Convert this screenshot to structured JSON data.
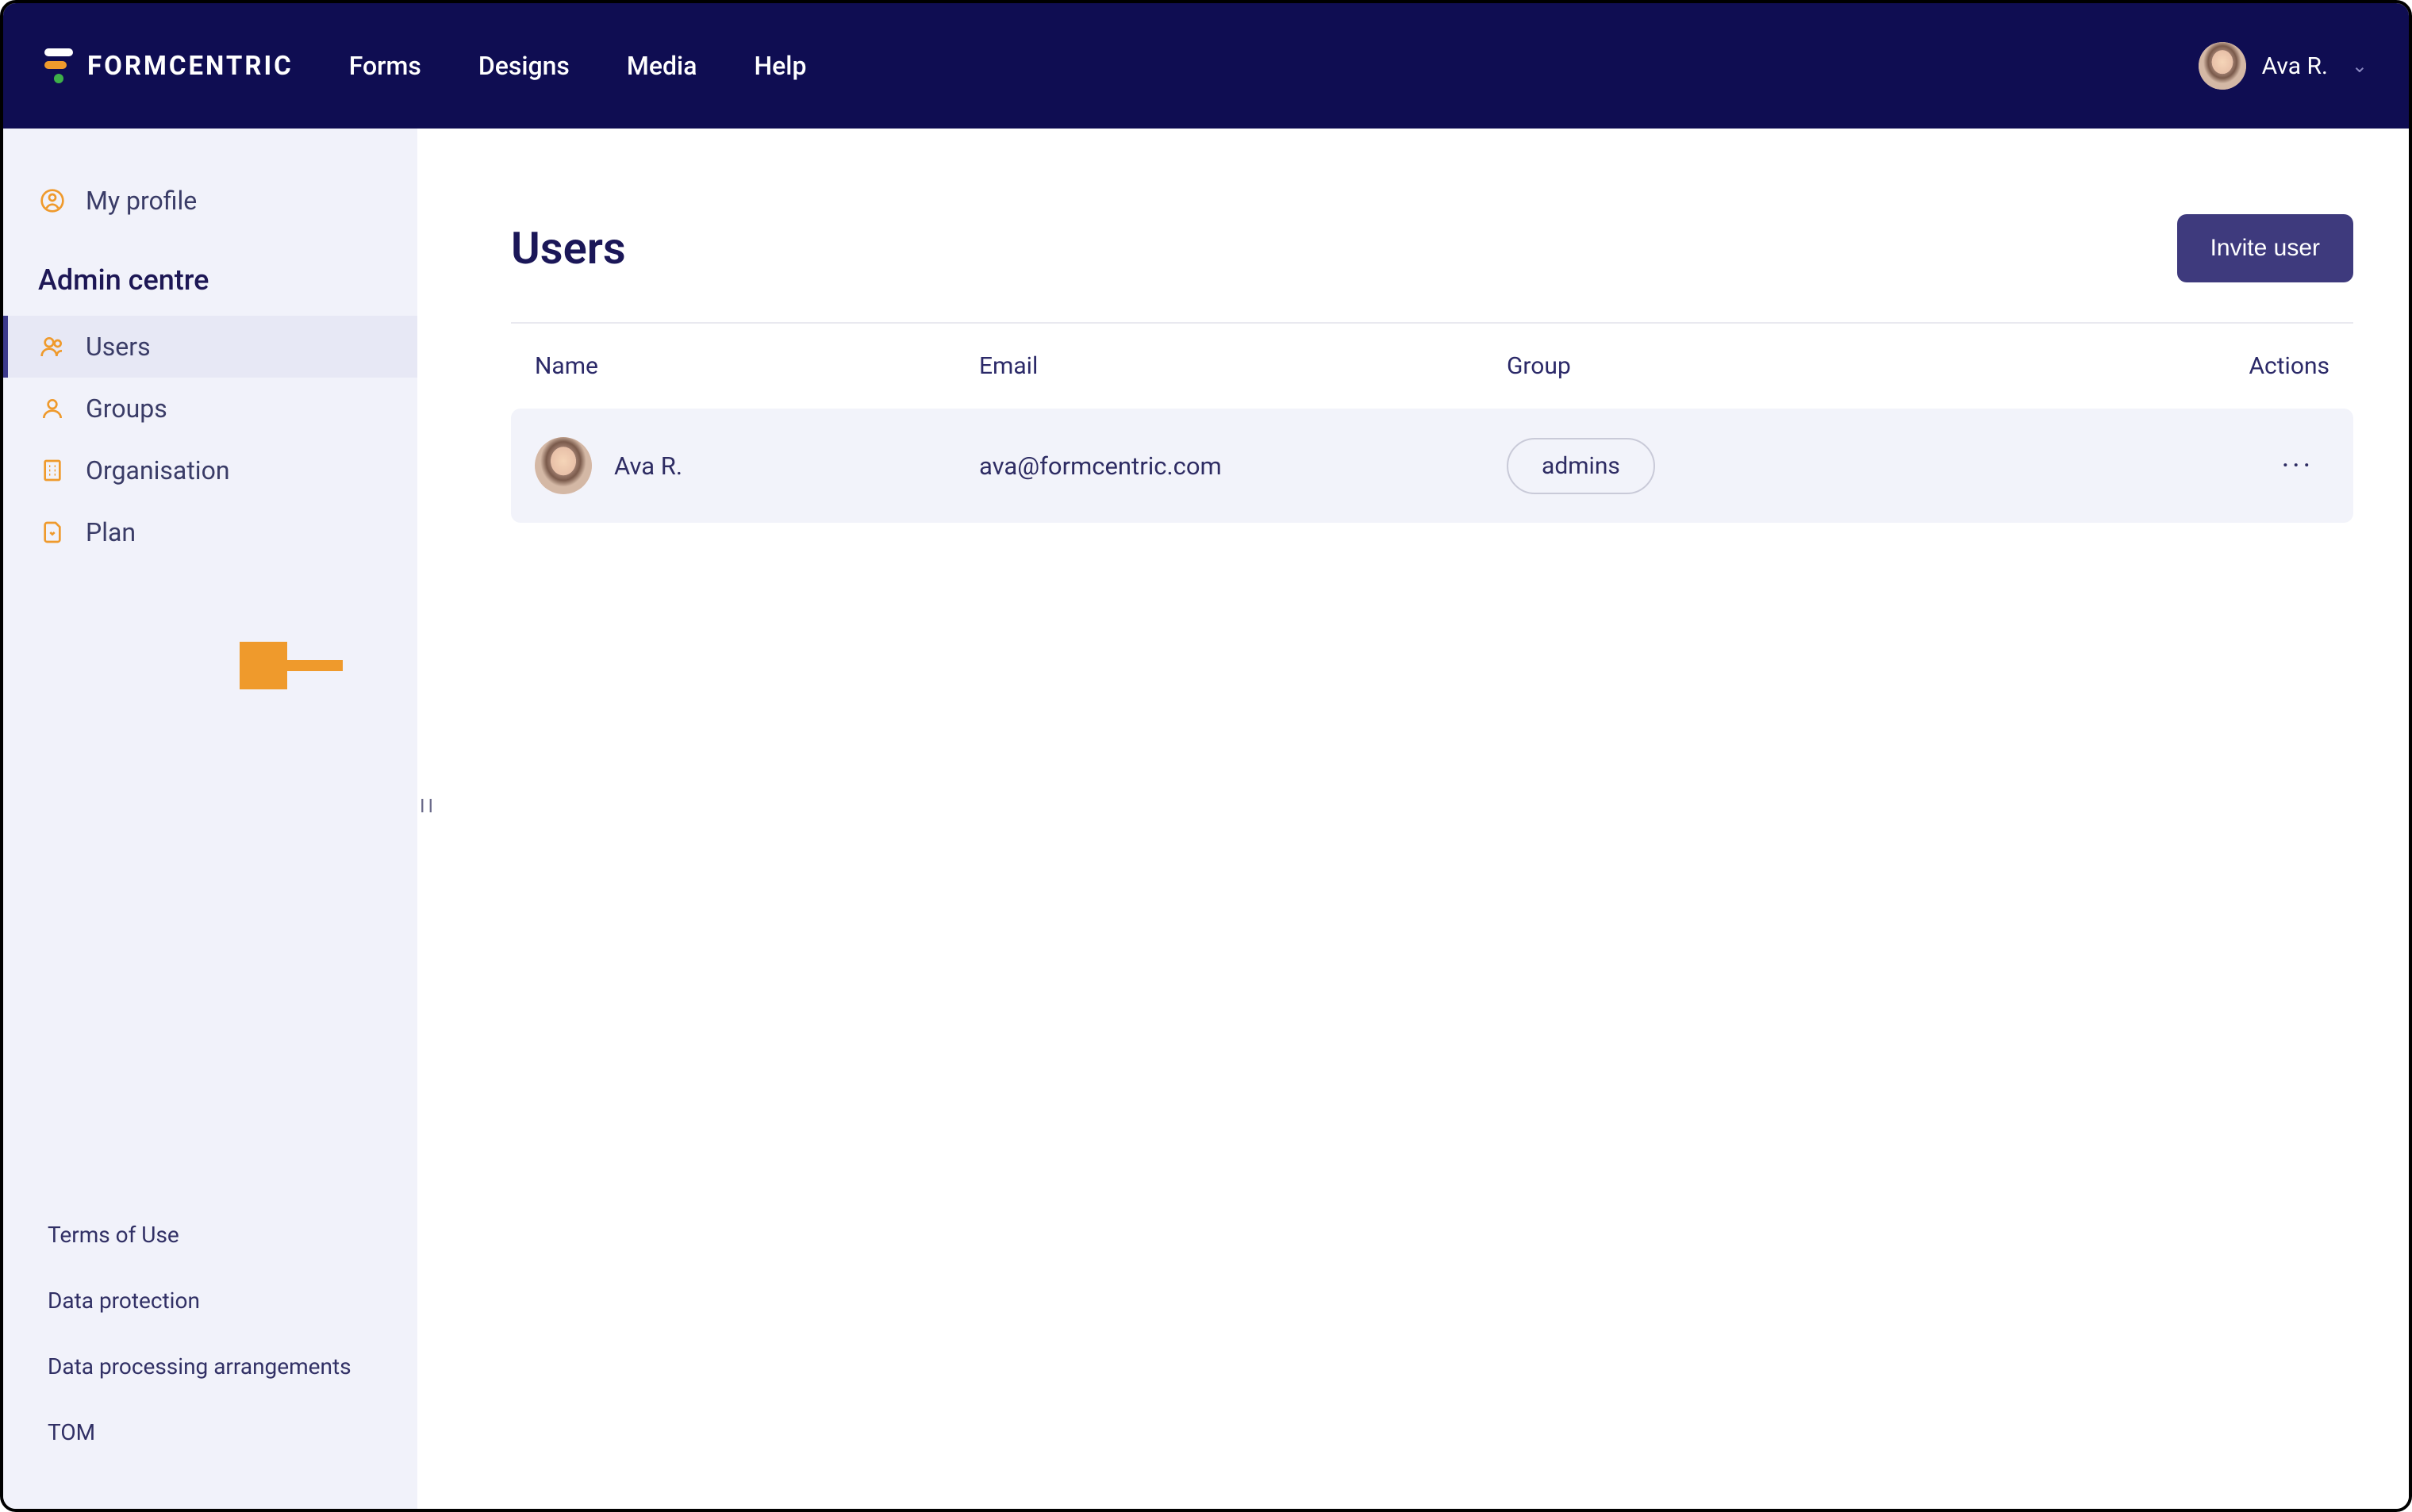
{
  "brand": {
    "name": "FORMCENTRIC"
  },
  "topnav": {
    "items": [
      "Forms",
      "Designs",
      "Media",
      "Help"
    ]
  },
  "user": {
    "display_name": "Ava R."
  },
  "sidebar": {
    "profile_label": "My profile",
    "section_title": "Admin centre",
    "items": [
      {
        "label": "Users"
      },
      {
        "label": "Groups"
      },
      {
        "label": "Organisation"
      },
      {
        "label": "Plan"
      }
    ],
    "footer_links": [
      "Terms of Use",
      "Data protection",
      "Data processing arrangements",
      "TOM"
    ]
  },
  "page": {
    "title": "Users",
    "invite_button": "Invite user",
    "columns": {
      "name": "Name",
      "email": "Email",
      "group": "Group",
      "actions": "Actions"
    },
    "rows": [
      {
        "name": "Ava R.",
        "email": "ava@formcentric.com",
        "group": "admins"
      }
    ]
  }
}
